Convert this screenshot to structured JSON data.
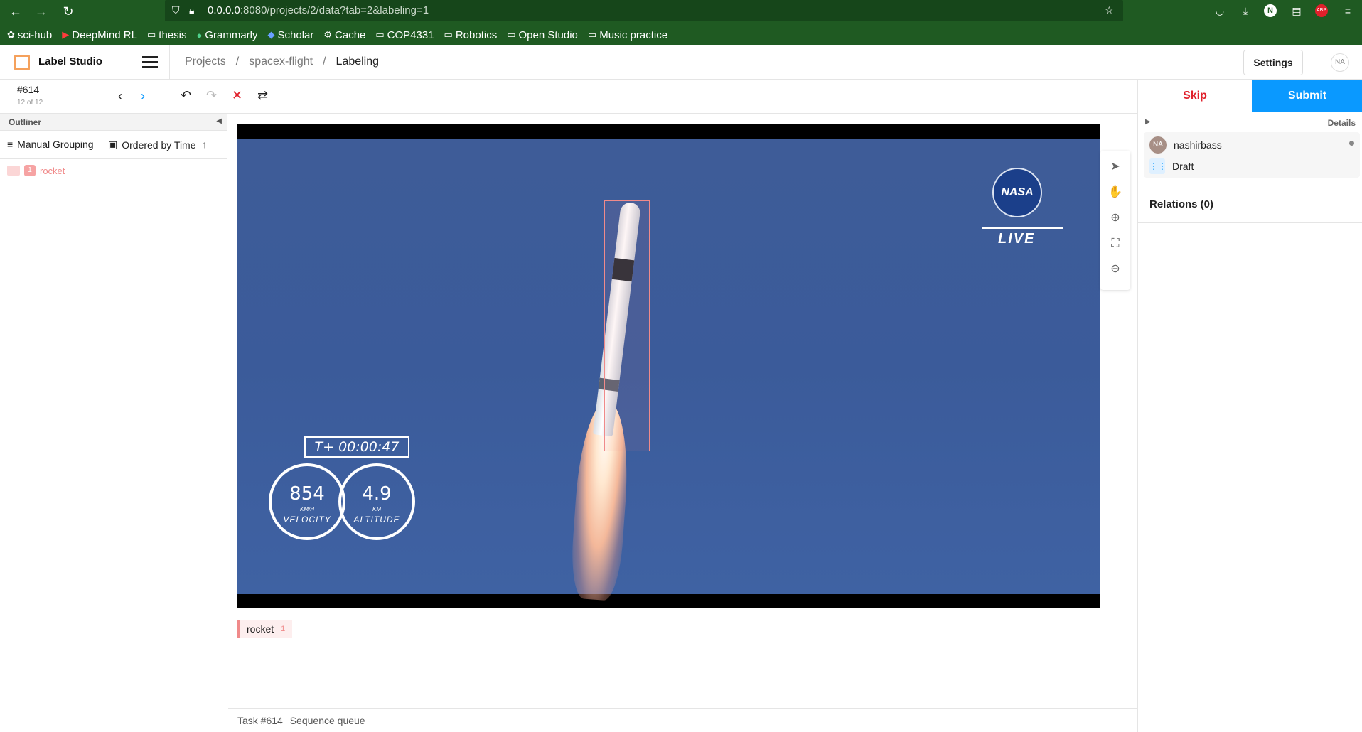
{
  "browser": {
    "url_host": "0.0.0.0",
    "url_rest": ":8080/projects/2/data?tab=2&labeling=1",
    "bookmarks": [
      {
        "label": "sci-hub",
        "icon": "sci-hub-icon"
      },
      {
        "label": "DeepMind RL",
        "icon": "youtube-icon"
      },
      {
        "label": "thesis",
        "icon": "folder-icon"
      },
      {
        "label": "Grammarly",
        "icon": "grammarly-icon"
      },
      {
        "label": "Scholar",
        "icon": "scholar-icon"
      },
      {
        "label": "Cache",
        "icon": "gear-icon"
      },
      {
        "label": "COP4331",
        "icon": "folder-icon"
      },
      {
        "label": "Robotics",
        "icon": "folder-icon"
      },
      {
        "label": "Open Studio",
        "icon": "folder-icon"
      },
      {
        "label": "Music practice",
        "icon": "folder-icon"
      }
    ]
  },
  "app": {
    "title": "Label Studio",
    "breadcrumb": [
      "Projects",
      "spacex-flight",
      "Labeling"
    ],
    "settings_label": "Settings",
    "user_initials": "NA"
  },
  "task": {
    "id": "#614",
    "count": "12 of 12"
  },
  "actions": {
    "skip": "Skip",
    "submit": "Submit"
  },
  "outliner": {
    "title": "Outliner",
    "grouping": "Manual Grouping",
    "ordering": "Ordered by Time",
    "regions": [
      {
        "num": "1",
        "label": "rocket"
      }
    ]
  },
  "details": {
    "title": "Details",
    "annotator": "nashirbass",
    "annotator_initials": "NA",
    "draft": "Draft",
    "relations": "Relations (0)"
  },
  "image": {
    "timer": "T+ 00:00:47",
    "velocity_value": "854",
    "velocity_unit": "KM/H",
    "velocity_label": "VELOCITY",
    "altitude_value": "4.9",
    "altitude_unit": "KM",
    "altitude_label": "ALTITUDE",
    "logo_text": "NASA",
    "live_text": "LIVE"
  },
  "labels": [
    {
      "name": "rocket",
      "hotkey": "1",
      "color": "#f08a8a"
    }
  ],
  "footer": {
    "task": "Task #614",
    "queue": "Sequence queue"
  },
  "colors": {
    "browser_chrome": "#1f5a22",
    "submit": "#0a99ff",
    "skip": "#e0202b",
    "region": "#f08a8a"
  }
}
